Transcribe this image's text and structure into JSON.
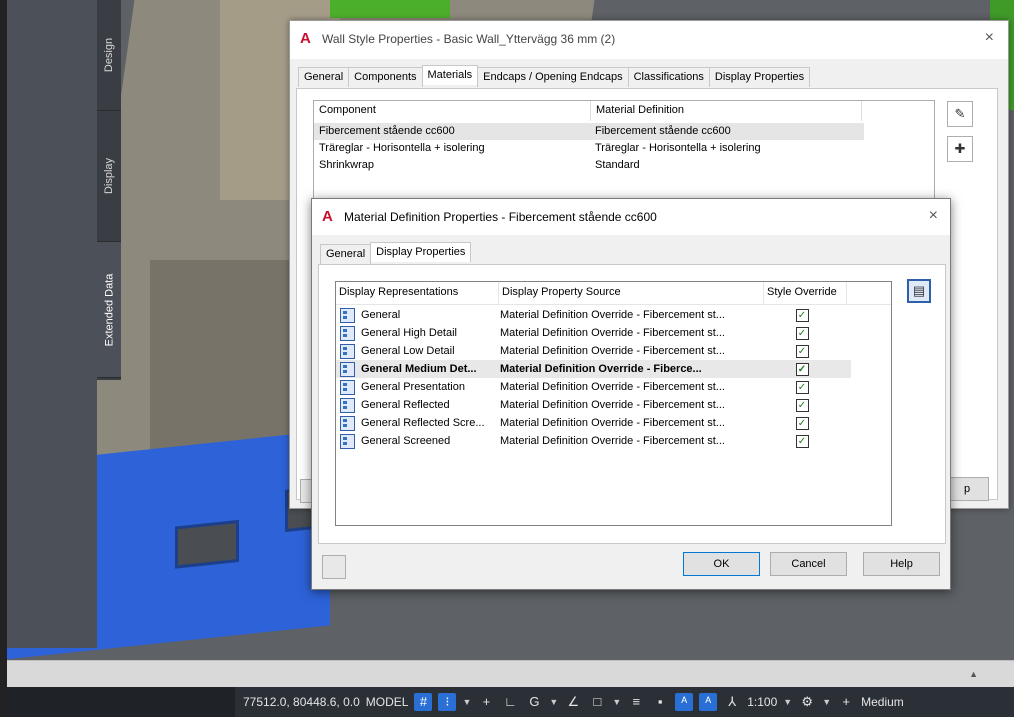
{
  "palette": {
    "tabs": [
      "Design",
      "Display",
      "Extended Data"
    ]
  },
  "wall_dialog": {
    "logo": "A",
    "title": "Wall Style Properties - Basic Wall_Yttervägg 36 mm (2)",
    "close": "×",
    "tabs": [
      "General",
      "Components",
      "Materials",
      "Endcaps / Opening Endcaps",
      "Classifications",
      "Display Properties"
    ],
    "active_tab": "Materials",
    "columns": [
      "Component",
      "Material Definition"
    ],
    "rows": [
      {
        "component": "Fibercement stående cc600",
        "material": "Fibercement stående cc600"
      },
      {
        "component": "Träreglar - Horisontella + isolering",
        "material": "Träreglar - Horisontella + isolering"
      },
      {
        "component": "Shrinkwrap",
        "material": "Standard"
      }
    ],
    "help_fragment": "p"
  },
  "material_dialog": {
    "logo": "A",
    "title": "Material Definition Properties - Fibercement stående cc600",
    "close": "×",
    "tabs": [
      "General",
      "Display Properties"
    ],
    "active_tab": "Display Properties",
    "columns": [
      "Display Representations",
      "Display Property Source",
      "Style Override"
    ],
    "rows": [
      {
        "rep": "General",
        "source": "Material Definition Override - Fibercement st...",
        "override": true
      },
      {
        "rep": "General High Detail",
        "source": "Material Definition Override - Fibercement st...",
        "override": true
      },
      {
        "rep": "General Low Detail",
        "source": "Material Definition Override - Fibercement st...",
        "override": true
      },
      {
        "rep": "General Medium Det...",
        "source": "Material Definition Override - Fiberce...",
        "override": true
      },
      {
        "rep": "General Presentation",
        "source": "Material Definition Override - Fibercement st...",
        "override": true
      },
      {
        "rep": "General Reflected",
        "source": "Material Definition Override - Fibercement st...",
        "override": true
      },
      {
        "rep": "General Reflected Scre...",
        "source": "Material Definition Override - Fibercement st...",
        "override": true
      },
      {
        "rep": "General Screened",
        "source": "Material Definition Override - Fibercement st...",
        "override": true
      }
    ],
    "selected_row": 3,
    "buttons": {
      "ok": "OK",
      "cancel": "Cancel",
      "help": "Help"
    }
  },
  "statusbar": {
    "coords": "77512.0, 80448.6, 0.0",
    "model": "MODEL",
    "scale": "1:100",
    "detail": "Medium"
  },
  "colors": {
    "accent": "#2a6fd6",
    "logo": "#c8102e",
    "model_blue": "#2d62d8"
  }
}
